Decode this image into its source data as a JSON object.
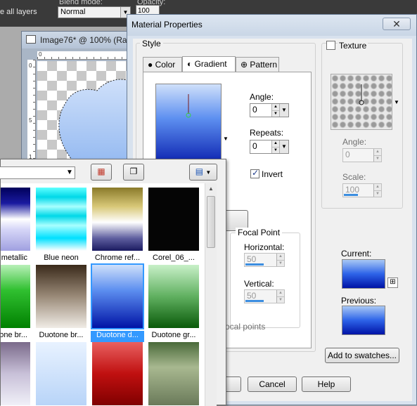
{
  "toolbar": {
    "layers_option": "e all layers",
    "blend_mode_label": "Blend mode:",
    "blend_mode_value": "Normal",
    "opacity_label": "Opacity:",
    "opacity_value": "100"
  },
  "document_window": {
    "title": "Image76* @ 100% (Ras",
    "ruler_h_mark": "0",
    "ruler_v_marks": [
      "0",
      "5",
      "1",
      "0"
    ]
  },
  "dialog": {
    "title": "Material Properties",
    "close_icon": "close-icon",
    "style_label": "Style",
    "tabs": [
      {
        "label": "Color",
        "icon": "dot-icon"
      },
      {
        "label": "Gradient",
        "icon": "half-circle-icon"
      },
      {
        "label": "Pattern",
        "icon": "pattern-icon"
      }
    ],
    "gradient": {
      "angle_label": "Angle:",
      "angle_value": "0",
      "repeats_label": "Repeats:",
      "repeats_value": "0",
      "invert_label": "Invert",
      "invert_checked": true,
      "focal_point_label": "Focal Point",
      "horizontal_label": "Horizontal:",
      "horizontal_value": "50",
      "vertical_label": "Vertical:",
      "vertical_value": "50",
      "focal_points_text": "ocal points"
    },
    "texture": {
      "label": "Texture",
      "checked": false,
      "angle_label": "Angle:",
      "angle_value": "0",
      "scale_label": "Scale:",
      "scale_value": "100"
    },
    "current_label": "Current:",
    "previous_label": "Previous:",
    "add_to_swatches": "Add to swatches...",
    "cancel": "Cancel",
    "help": "Help"
  },
  "preset_popup": {
    "presets": [
      {
        "name": "metallic"
      },
      {
        "name": "Blue neon"
      },
      {
        "name": "Chrome ref..."
      },
      {
        "name": "Corel_06_..."
      },
      {
        "name": "one br..."
      },
      {
        "name": "Duotone br..."
      },
      {
        "name": "Duotone d...",
        "selected": true
      },
      {
        "name": "Duotone gr..."
      },
      {
        "name": ""
      },
      {
        "name": ""
      },
      {
        "name": ""
      },
      {
        "name": ""
      }
    ]
  },
  "colors": {
    "accent": "#3399ff",
    "gradient_top": "#a8c8f5",
    "gradient_bottom": "#0013a6"
  }
}
